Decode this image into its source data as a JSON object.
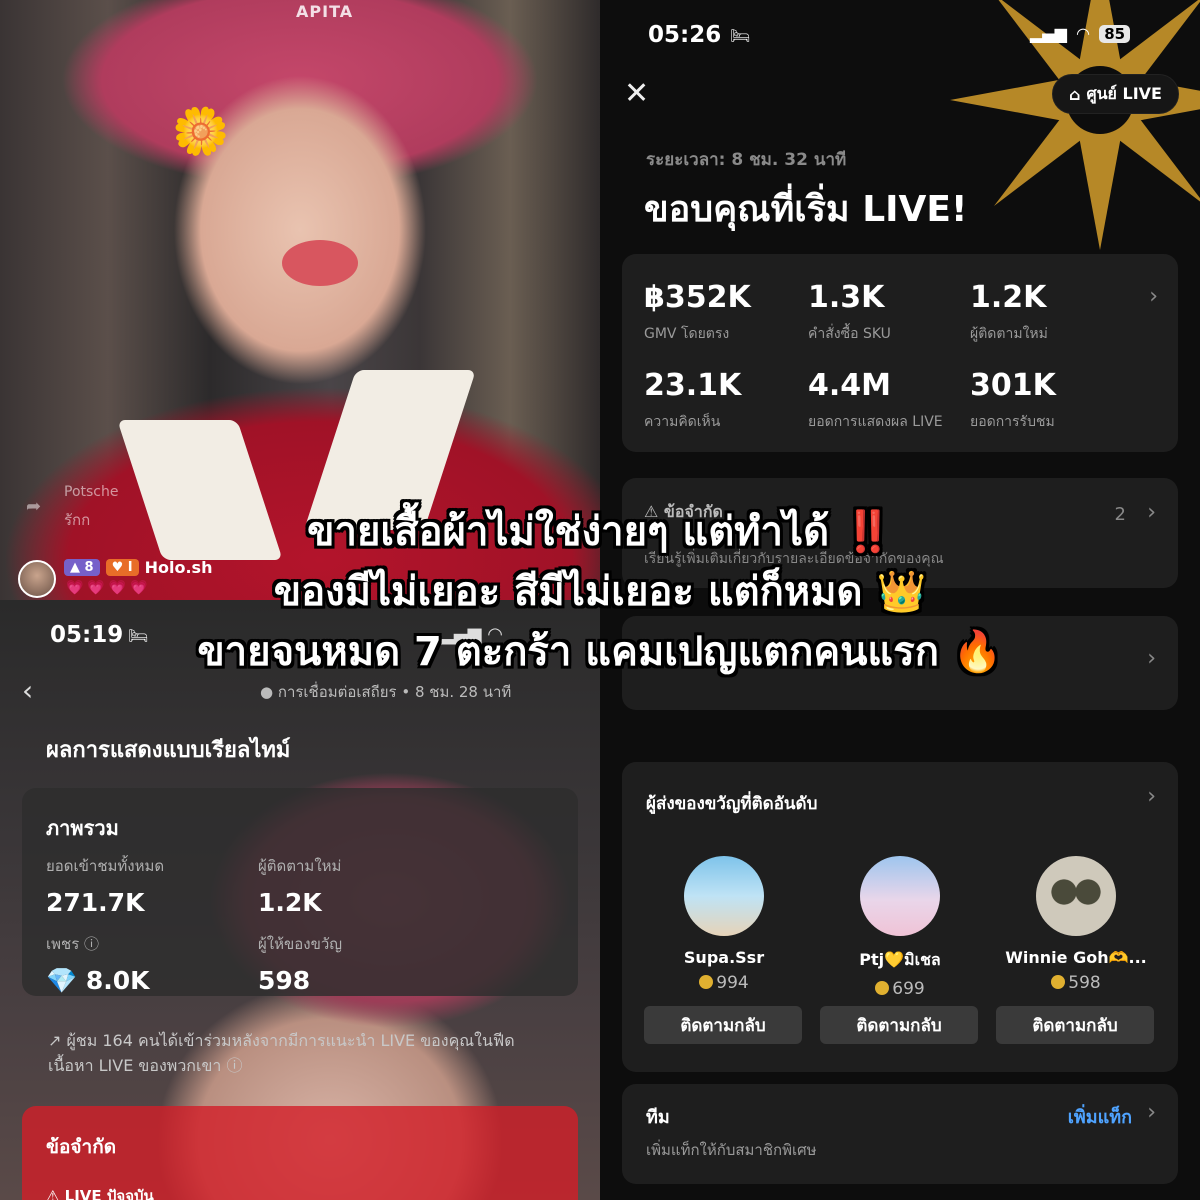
{
  "top_photo": {
    "hat_logo": "APITA",
    "overlay_name": "Potsche",
    "overlay_message": "รักก",
    "badge_level": "8",
    "badge_heart": "I",
    "username": "Holo.sh",
    "hearts": "💗💗💗💗"
  },
  "right_phone": {
    "status_time": "05:26",
    "battery": "85",
    "live_center_label": "ศูนย์ LIVE",
    "duration": "ระยะเวลา: 8 ชม. 32 นาที",
    "title": "ขอบคุณที่เริ่ม LIVE!",
    "stats": [
      {
        "value": "฿352K",
        "label": "GMV โดยตรง"
      },
      {
        "value": "1.3K",
        "label": "คำสั่งซื้อ SKU"
      },
      {
        "value": "1.2K",
        "label": "ผู้ติดตามใหม่"
      },
      {
        "value": "23.1K",
        "label": "ความคิดเห็น"
      },
      {
        "value": "4.4M",
        "label": "ยอดการแสดงผล LIVE"
      },
      {
        "value": "301K",
        "label": "ยอดการรับชม"
      }
    ],
    "limits": {
      "title": "ข้อจำกัด",
      "subtitle": "เรียนรู้เพิ่มเติมเกี่ยวกับรายละเอียดข้อจำกัดของคุณ",
      "count": "2"
    },
    "top_gifters": {
      "title": "ผู้ส่งของขวัญที่ติดอันดับ",
      "gifters": [
        {
          "name": "Supa.Ssr",
          "coins": "994"
        },
        {
          "name": "Ptj💛มิเชล",
          "coins": "699"
        },
        {
          "name": "Winnie Goh🫶...",
          "coins": "598"
        }
      ],
      "follow_label": "ติดตามกลับ"
    },
    "team": {
      "title": "ทีม",
      "subtitle": "เพิ่มแท็กให้กับสมาชิกพิเศษ",
      "add_label": "เพิ่มแท็ก"
    }
  },
  "left_phone": {
    "status_time": "05:19",
    "connection_status": "● การเชื่อมต่อเสถียร • 8 ชม. 28 นาที",
    "title": "ผลการแสดงแบบเรียลไทม์",
    "overview": {
      "title": "ภาพรวม",
      "total_views_label": "ยอดเข้าชมทั้งหมด",
      "total_views": "271.7K",
      "new_followers_label": "ผู้ติดตามใหม่",
      "new_followers": "1.2K",
      "diamonds_label": "เพชร",
      "diamonds": "8.0K",
      "gifters_label": "ผู้ให้ของขวัญ",
      "gifters": "598"
    },
    "viewer_note": "ผู้ชม 164 คนได้เข้าร่วมหลังจากมีการแนะนำ LIVE ของคุณในฟีดเนื้อหา LIVE ของพวกเขา",
    "limits": {
      "title": "ข้อจำกัด",
      "status": "LIVE ปัจจุบัน"
    }
  },
  "caption": {
    "line1": "ขายเสื้อผ้าไม่ใช่ง่ายๆ แต่ทำได้",
    "line1_emoji": "‼️",
    "line2": "ของมีไม่เยอะ สีมีไม่เยอะ แต่ก็หมด",
    "line2_emoji": "👑",
    "line3": "ขายจนหมด 7 ตะกร้า แคมเปญแตกคนแรก",
    "line3_emoji": "🔥"
  },
  "colors": {
    "accent_link": "#4fa3ff",
    "starburst": "#c9962a",
    "limit_red": "#d21e28",
    "coin": "#e0b030"
  }
}
